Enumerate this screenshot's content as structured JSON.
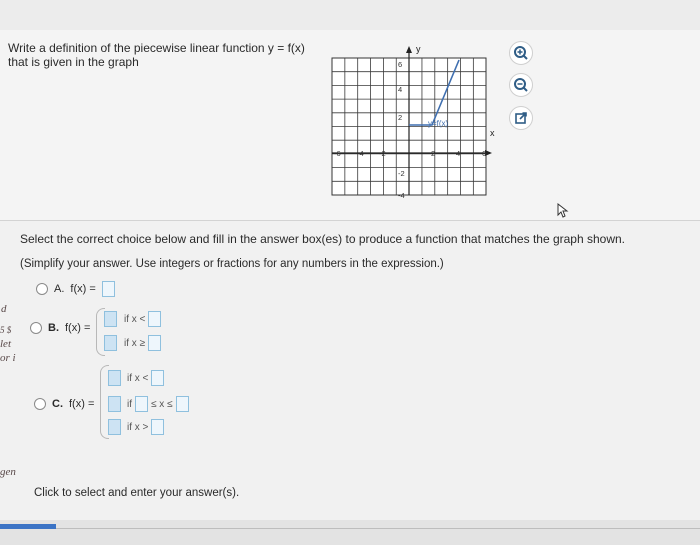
{
  "question": {
    "line1": "Write a definition of the piecewise linear function y = f(x)",
    "line2": "that is given in the graph"
  },
  "graph": {
    "y_axis_label": "y",
    "x_axis_label": "x",
    "curve_label": "y=f(x)",
    "x_ticks": [
      "-6",
      "-4",
      "-2",
      "2",
      "4",
      "6"
    ],
    "y_ticks": [
      "6",
      "4",
      "2",
      "-2",
      "-4"
    ],
    "line_color": "#3f6fb0"
  },
  "tools": {
    "zoom_in_icon": "zoom-in-icon",
    "zoom_out_icon": "zoom-out-icon",
    "popout_icon": "external-link-icon"
  },
  "instructions": {
    "main": "Select the correct choice below and fill in the answer box(es) to produce a function that matches the graph shown.",
    "note": "(Simplify your answer. Use integers or fractions for any numbers in the expression.)"
  },
  "options": {
    "a": {
      "letter": "A.",
      "fx": "f(x) ="
    },
    "b": {
      "letter": "B.",
      "fx": "f(x) =",
      "cond1": "if x <",
      "cond2": "if x ≥"
    },
    "c": {
      "letter": "C.",
      "fx": "f(x) =",
      "cond1": "if x <",
      "cond2_if": "if",
      "cond2_mid": "≤ x ≤",
      "cond3": "if x >"
    }
  },
  "footer": {
    "click_text": "Click to select and enter your answer(s)."
  },
  "margin": {
    "m1": "d",
    "m2": "5 $",
    "m3": "let",
    "m4": "or i",
    "m5": "gen"
  }
}
